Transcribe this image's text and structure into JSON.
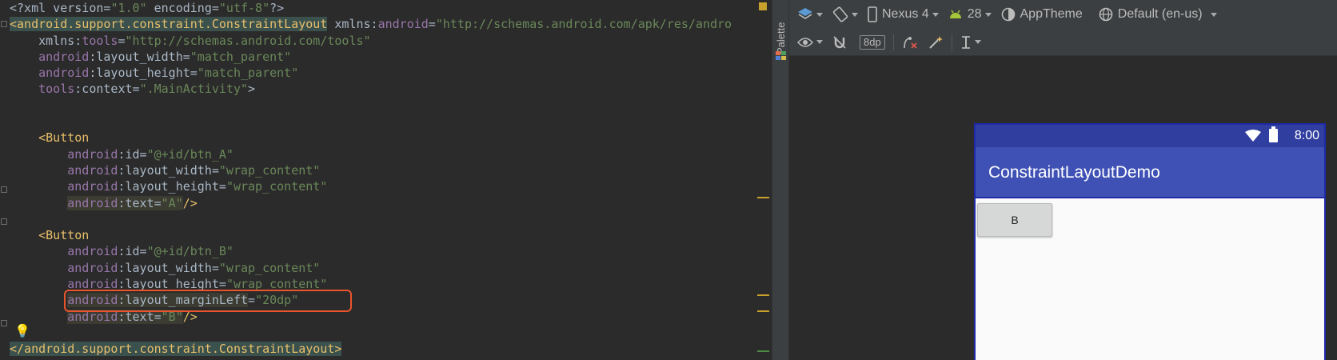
{
  "editor": {
    "lines": [
      [
        {
          "t": "<?xml version=",
          "c": "t-txt"
        },
        {
          "t": "\"1.0\"",
          "c": "t-val"
        },
        {
          "t": " encoding=",
          "c": "t-txt"
        },
        {
          "t": "\"utf-8\"",
          "c": "t-val"
        },
        {
          "t": "?>",
          "c": "t-txt"
        }
      ],
      [
        {
          "t": "<android.support.constraint.ConstraintLayout",
          "c": "t-tag hl-tag"
        },
        {
          "t": " xmlns:",
          "c": "t-txt"
        },
        {
          "t": "android",
          "c": "t-ns"
        },
        {
          "t": "=",
          "c": "t-txt"
        },
        {
          "t": "\"http://schemas.android.com/apk/res/andro",
          "c": "t-val"
        }
      ],
      [
        {
          "t": "    xmlns:",
          "c": "t-txt"
        },
        {
          "t": "tools",
          "c": "t-ns"
        },
        {
          "t": "=",
          "c": "t-txt"
        },
        {
          "t": "\"http://schemas.android.com/tools\"",
          "c": "t-val"
        }
      ],
      [
        {
          "t": "    ",
          "c": "t-txt"
        },
        {
          "t": "android",
          "c": "t-ns"
        },
        {
          "t": ":layout_width=",
          "c": "t-txt"
        },
        {
          "t": "\"match_parent\"",
          "c": "t-val"
        }
      ],
      [
        {
          "t": "    ",
          "c": "t-txt"
        },
        {
          "t": "android",
          "c": "t-ns"
        },
        {
          "t": ":layout_height=",
          "c": "t-txt"
        },
        {
          "t": "\"match_parent\"",
          "c": "t-val"
        }
      ],
      [
        {
          "t": "    ",
          "c": "t-txt"
        },
        {
          "t": "tools",
          "c": "t-ns"
        },
        {
          "t": ":context=",
          "c": "t-txt"
        },
        {
          "t": "\".MainActivity\"",
          "c": "t-val"
        },
        {
          "t": ">",
          "c": "t-txt"
        }
      ],
      [],
      [],
      [
        {
          "t": "    ",
          "c": "t-txt"
        },
        {
          "t": "<Button",
          "c": "t-tag"
        }
      ],
      [
        {
          "t": "        ",
          "c": "t-txt"
        },
        {
          "t": "android",
          "c": "t-ns"
        },
        {
          "t": ":id=",
          "c": "t-txt"
        },
        {
          "t": "\"@+id/btn_A\"",
          "c": "t-val"
        }
      ],
      [
        {
          "t": "        ",
          "c": "t-txt"
        },
        {
          "t": "android",
          "c": "t-ns"
        },
        {
          "t": ":layout_width=",
          "c": "t-txt"
        },
        {
          "t": "\"wrap_content\"",
          "c": "t-val"
        }
      ],
      [
        {
          "t": "        ",
          "c": "t-txt"
        },
        {
          "t": "android",
          "c": "t-ns"
        },
        {
          "t": ":layout_height=",
          "c": "t-txt"
        },
        {
          "t": "\"wrap_content\"",
          "c": "t-val"
        }
      ],
      [
        {
          "t": "        ",
          "c": "t-txt"
        },
        {
          "t": "android",
          "c": "t-ns hl-old"
        },
        {
          "t": ":text=",
          "c": "t-txt hl-old"
        },
        {
          "t": "\"A\"",
          "c": "t-val hl-old"
        },
        {
          "t": "/>",
          "c": "t-tag"
        }
      ],
      [],
      [
        {
          "t": "    ",
          "c": "t-txt"
        },
        {
          "t": "<Button",
          "c": "t-tag"
        }
      ],
      [
        {
          "t": "        ",
          "c": "t-txt"
        },
        {
          "t": "android",
          "c": "t-ns"
        },
        {
          "t": ":id=",
          "c": "t-txt"
        },
        {
          "t": "\"@+id/btn_B\"",
          "c": "t-val"
        }
      ],
      [
        {
          "t": "        ",
          "c": "t-txt"
        },
        {
          "t": "android",
          "c": "t-ns"
        },
        {
          "t": ":layout_width=",
          "c": "t-txt"
        },
        {
          "t": "\"wrap_content\"",
          "c": "t-val"
        }
      ],
      [
        {
          "t": "        ",
          "c": "t-txt"
        },
        {
          "t": "android",
          "c": "t-ns"
        },
        {
          "t": ":layout_height=",
          "c": "t-txt"
        },
        {
          "t": "\"wrap_content\"",
          "c": "t-val"
        }
      ],
      [
        {
          "t": "        ",
          "c": "t-txt"
        },
        {
          "t": "android",
          "c": "t-ns hl-old"
        },
        {
          "t": ":layout_marginLeft",
          "c": "t-txt hl-old"
        },
        {
          "t": "=",
          "c": "t-txt"
        },
        {
          "t": "\"20dp\"",
          "c": "t-val"
        }
      ],
      [
        {
          "t": "        ",
          "c": "t-txt"
        },
        {
          "t": "android",
          "c": "t-ns hl-old"
        },
        {
          "t": ":text=",
          "c": "t-txt hl-old"
        },
        {
          "t": "\"B\"",
          "c": "t-val hl-old"
        },
        {
          "t": "/>",
          "c": "t-tag"
        }
      ],
      [],
      [
        {
          "t": "</android.support.constraint.ConstraintLayout>",
          "c": "t-tag hl-tag"
        }
      ]
    ]
  },
  "palette": {
    "label": "Palette"
  },
  "toolbar": {
    "device": "Nexus 4",
    "api_level": "28",
    "theme": "AppTheme",
    "locale": "Default (en-us)",
    "margin": "8dp"
  },
  "preview": {
    "time": "8:00",
    "app_title": "ConstraintLayoutDemo",
    "button_label": "B"
  },
  "colors": {
    "accent_highlight": "#e8542b",
    "app_bar": "#3f51b5",
    "status_bar": "#303f9f"
  }
}
